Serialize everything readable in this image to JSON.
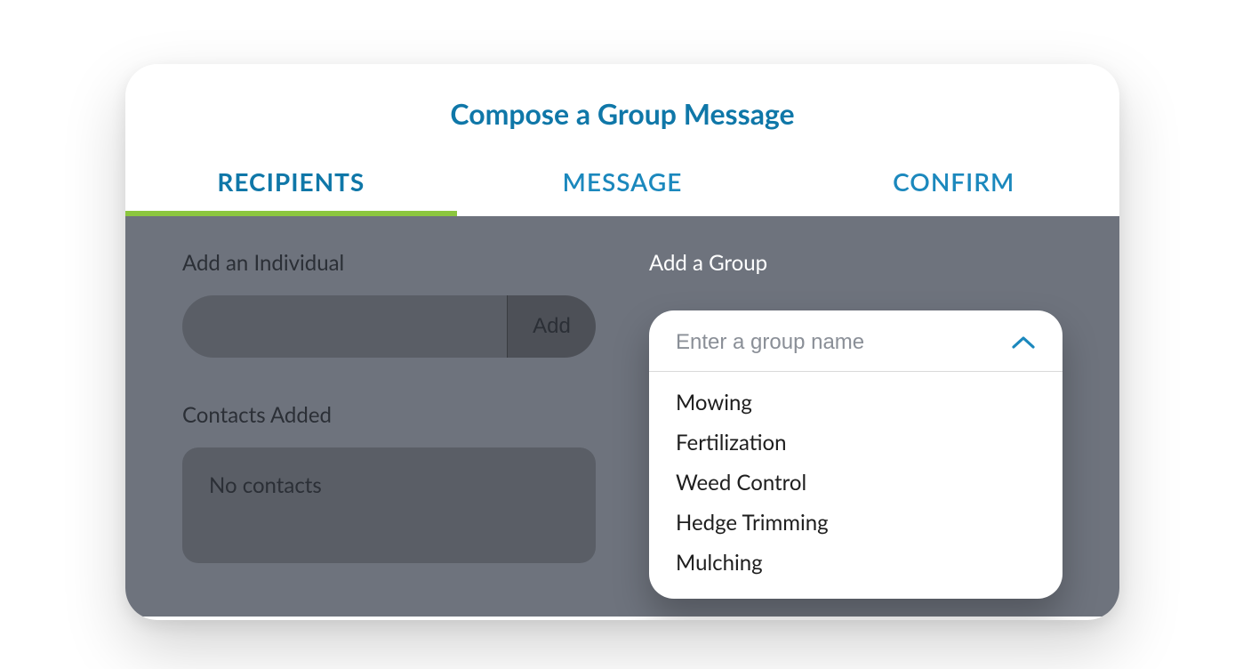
{
  "title": "Compose a Group Message",
  "tabs": [
    {
      "label": "RECIPIENTS",
      "active": true
    },
    {
      "label": "MESSAGE",
      "active": false
    },
    {
      "label": "CONFIRM",
      "active": false
    }
  ],
  "individual": {
    "section_label": "Add an Individual",
    "input_value": "",
    "add_button_label": "Add"
  },
  "contacts": {
    "section_label": "Contacts Added",
    "empty_text": "No contacts"
  },
  "group": {
    "section_label": "Add a Group",
    "input_placeholder": "Enter a group name",
    "options": [
      "Mowing",
      "Fertilization",
      "Weed Control",
      "Hedge Trimming",
      "Mulching"
    ]
  },
  "colors": {
    "accent_blue": "#1b88bd",
    "accent_green": "#8cc63f",
    "panel_gray": "#6e737d"
  }
}
